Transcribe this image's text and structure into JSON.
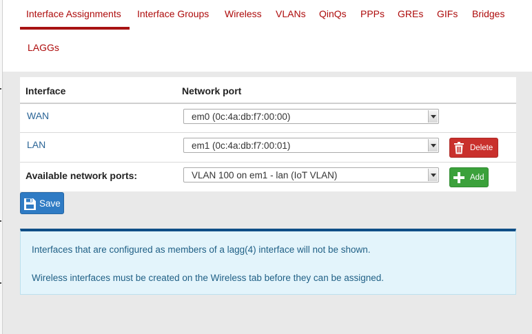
{
  "tabs": [
    {
      "label": "Interface Assignments",
      "active": true
    },
    {
      "label": "Interface Groups"
    },
    {
      "label": "Wireless"
    },
    {
      "label": "VLANs"
    },
    {
      "label": "QinQs"
    },
    {
      "label": "PPPs"
    },
    {
      "label": "GREs"
    },
    {
      "label": "GIFs"
    },
    {
      "label": "Bridges"
    },
    {
      "label": "LAGGs"
    }
  ],
  "table": {
    "headers": {
      "interface": "Interface",
      "network_port": "Network port"
    },
    "rows": [
      {
        "interface": "WAN",
        "port": "em0 (0c:4a:db:f7:00:00)"
      },
      {
        "interface": "LAN",
        "port": "em1 (0c:4a:db:f7:00:01)",
        "action": "Delete"
      }
    ],
    "available": {
      "label": "Available network ports:",
      "port": "VLAN 100 on em1 - lan (IoT VLAN)",
      "action": "Add"
    }
  },
  "save_label": "Save",
  "info": {
    "line1": "Interfaces that are configured as members of a lagg(4) interface will not be shown.",
    "line2": "Wireless interfaces must be created on the Wireless tab before they can be assigned."
  },
  "colors": {
    "tab_text": "#ad0a0a",
    "delete": "#c9302c",
    "add": "#3ba13b",
    "save": "#2f7bc4",
    "info_border": "#0f4e87"
  }
}
